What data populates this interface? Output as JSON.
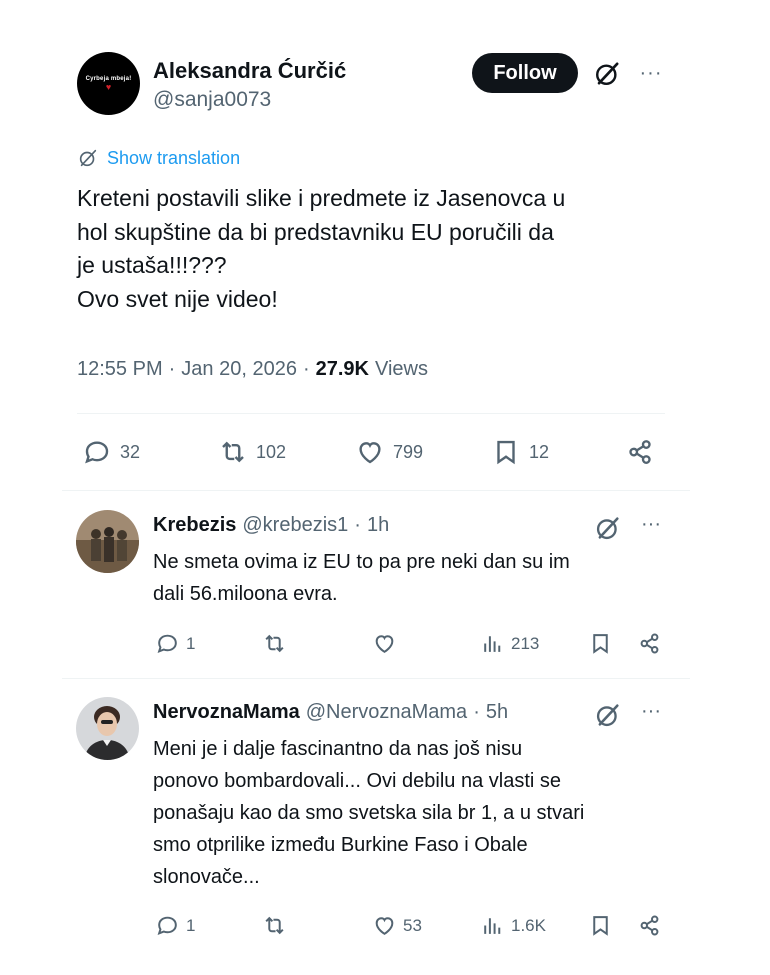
{
  "main_tweet": {
    "avatar_text": "Cyrbeja mbeja!",
    "name": "Aleksandra Ćurčić",
    "handle": "@sanja0073",
    "follow_label": "Follow",
    "more_label": "···",
    "show_translation": "Show translation",
    "text": "Kreteni postavili slike i predmete iz Jasenovca u\nhol skupštine da bi predstavniku EU poručili da\nje ustaša!!!???\nOvo svet nije video!",
    "time": "12:55 PM",
    "date": "Jan 20, 2026",
    "views_count": "27.9K",
    "views_label": "Views",
    "replies": "32",
    "reposts": "102",
    "likes": "799",
    "bookmarks": "12"
  },
  "replies": [
    {
      "name": "Krebezis",
      "handle": "@krebezis1",
      "time": "1h",
      "text": "Ne smeta ovima iz EU to pa pre neki dan su im\ndali 56.miloona evra.",
      "replies": "1",
      "reposts": "",
      "likes": "",
      "views": "213"
    },
    {
      "name": "NervoznaMama",
      "handle": "@NervoznaMama",
      "time": "5h",
      "text": "Meni je i dalje fascinantno da nas još nisu\nponovo bombardovali... Ovi debilu na vlasti se\nponašaju kao da smo svetska sila br 1, a u stvari\nsmo otprilike između Burkine Faso i Obale\nslonovače...",
      "replies": "1",
      "reposts": "",
      "likes": "53",
      "views": "1.6K"
    }
  ],
  "icons": {
    "grok": "grok-icon",
    "more": "more-icon",
    "reply": "reply-icon",
    "repost": "repost-icon",
    "like": "like-icon",
    "bookmark": "bookmark-icon",
    "share": "share-icon",
    "views": "views-icon"
  },
  "colors": {
    "accent": "#1d9bf0",
    "text": "#0f1419",
    "secondary": "#536471",
    "follow_bg": "#0f1419"
  }
}
